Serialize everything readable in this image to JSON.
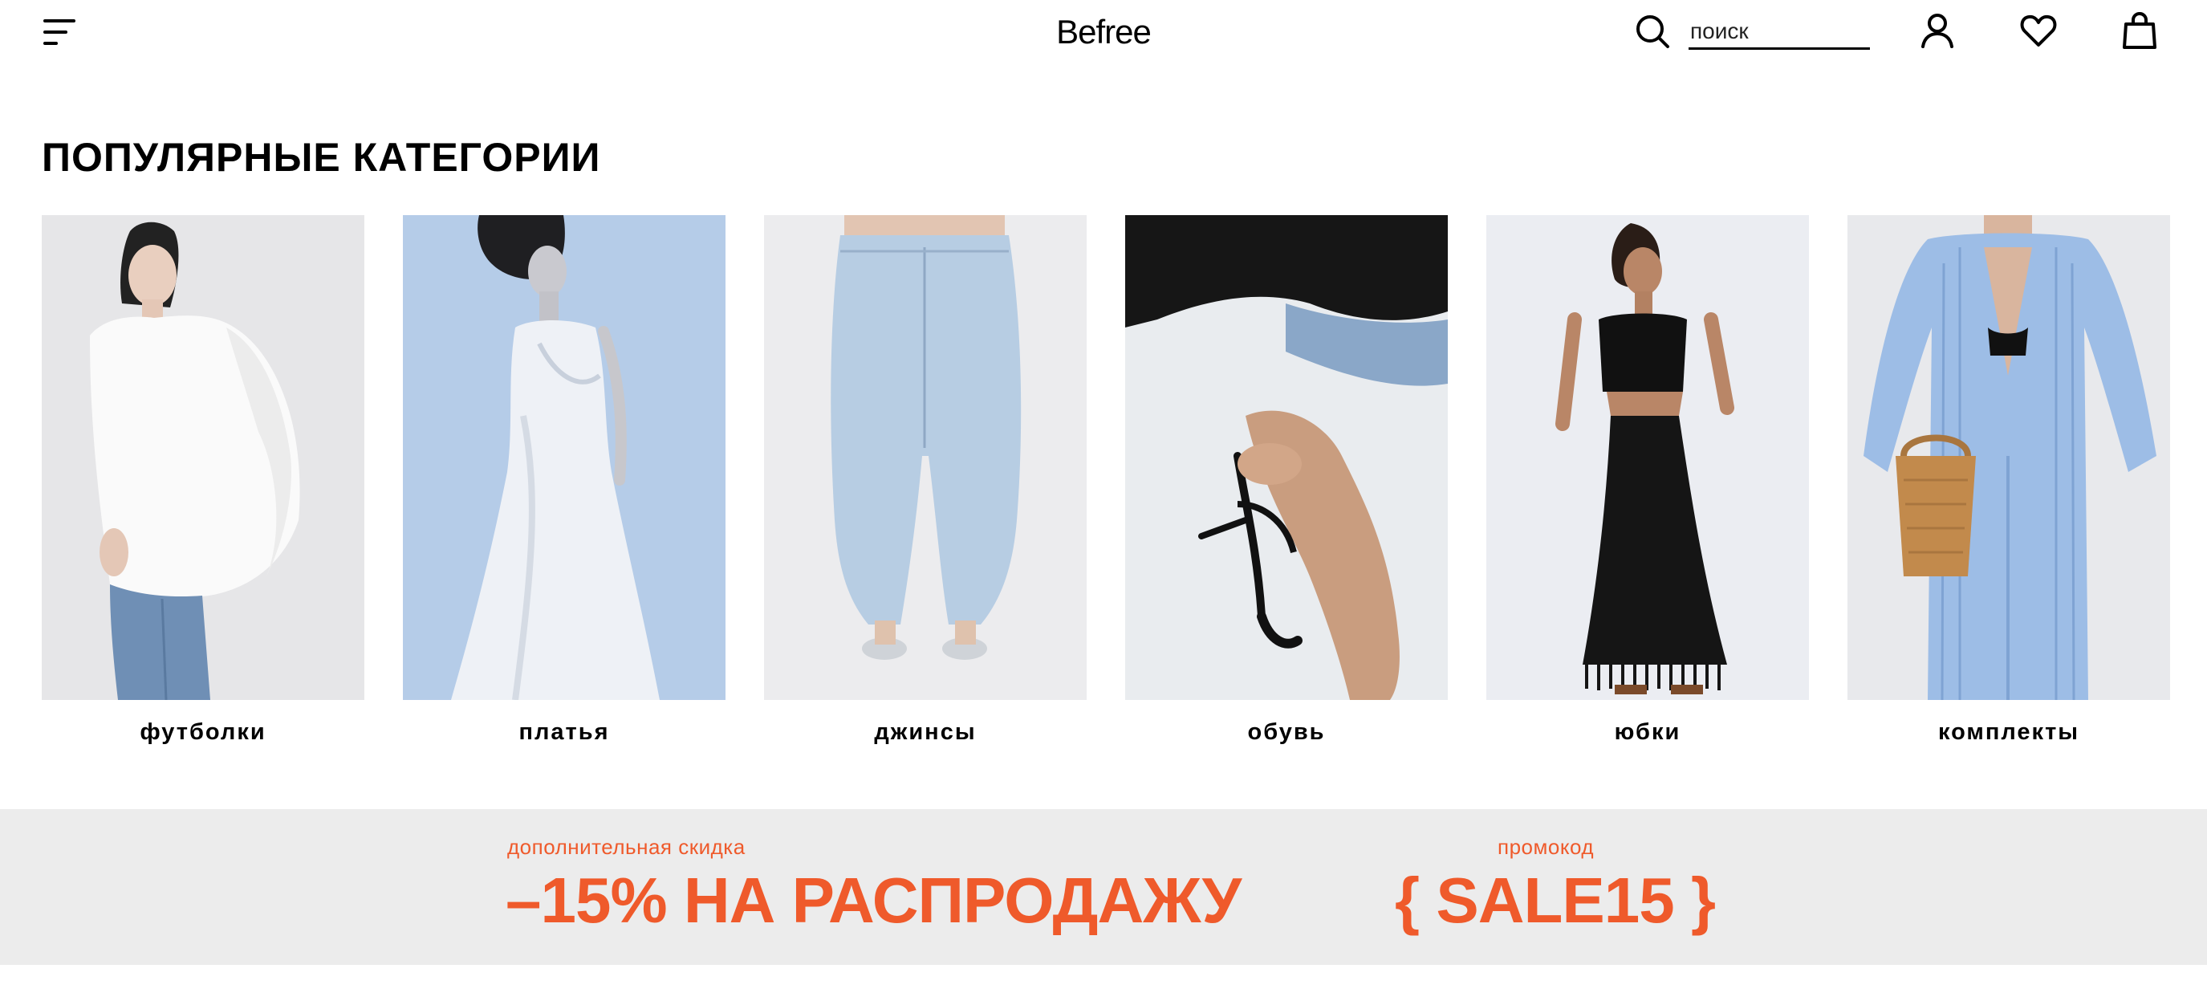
{
  "header": {
    "logo": "Befree",
    "search_placeholder": "поиск",
    "icons": [
      "menu-icon",
      "search-icon",
      "account-icon",
      "heart-icon",
      "bag-icon"
    ]
  },
  "popular": {
    "title": "ПОПУЛЯРНЫЕ КАТЕГОРИИ",
    "categories": [
      {
        "label": "футболки"
      },
      {
        "label": "платья"
      },
      {
        "label": "джинсы"
      },
      {
        "label": "обувь"
      },
      {
        "label": "юбки"
      },
      {
        "label": "комплекты"
      }
    ]
  },
  "promo": {
    "subtitle": "дополнительная скидка",
    "headline": "–15% НА РАСПРОДАЖУ",
    "code_label": "промокод",
    "code": "{ SALE15 }"
  },
  "colors": {
    "accent": "#ef5a2b",
    "banner_bg": "#ececec",
    "text": "#000000"
  }
}
